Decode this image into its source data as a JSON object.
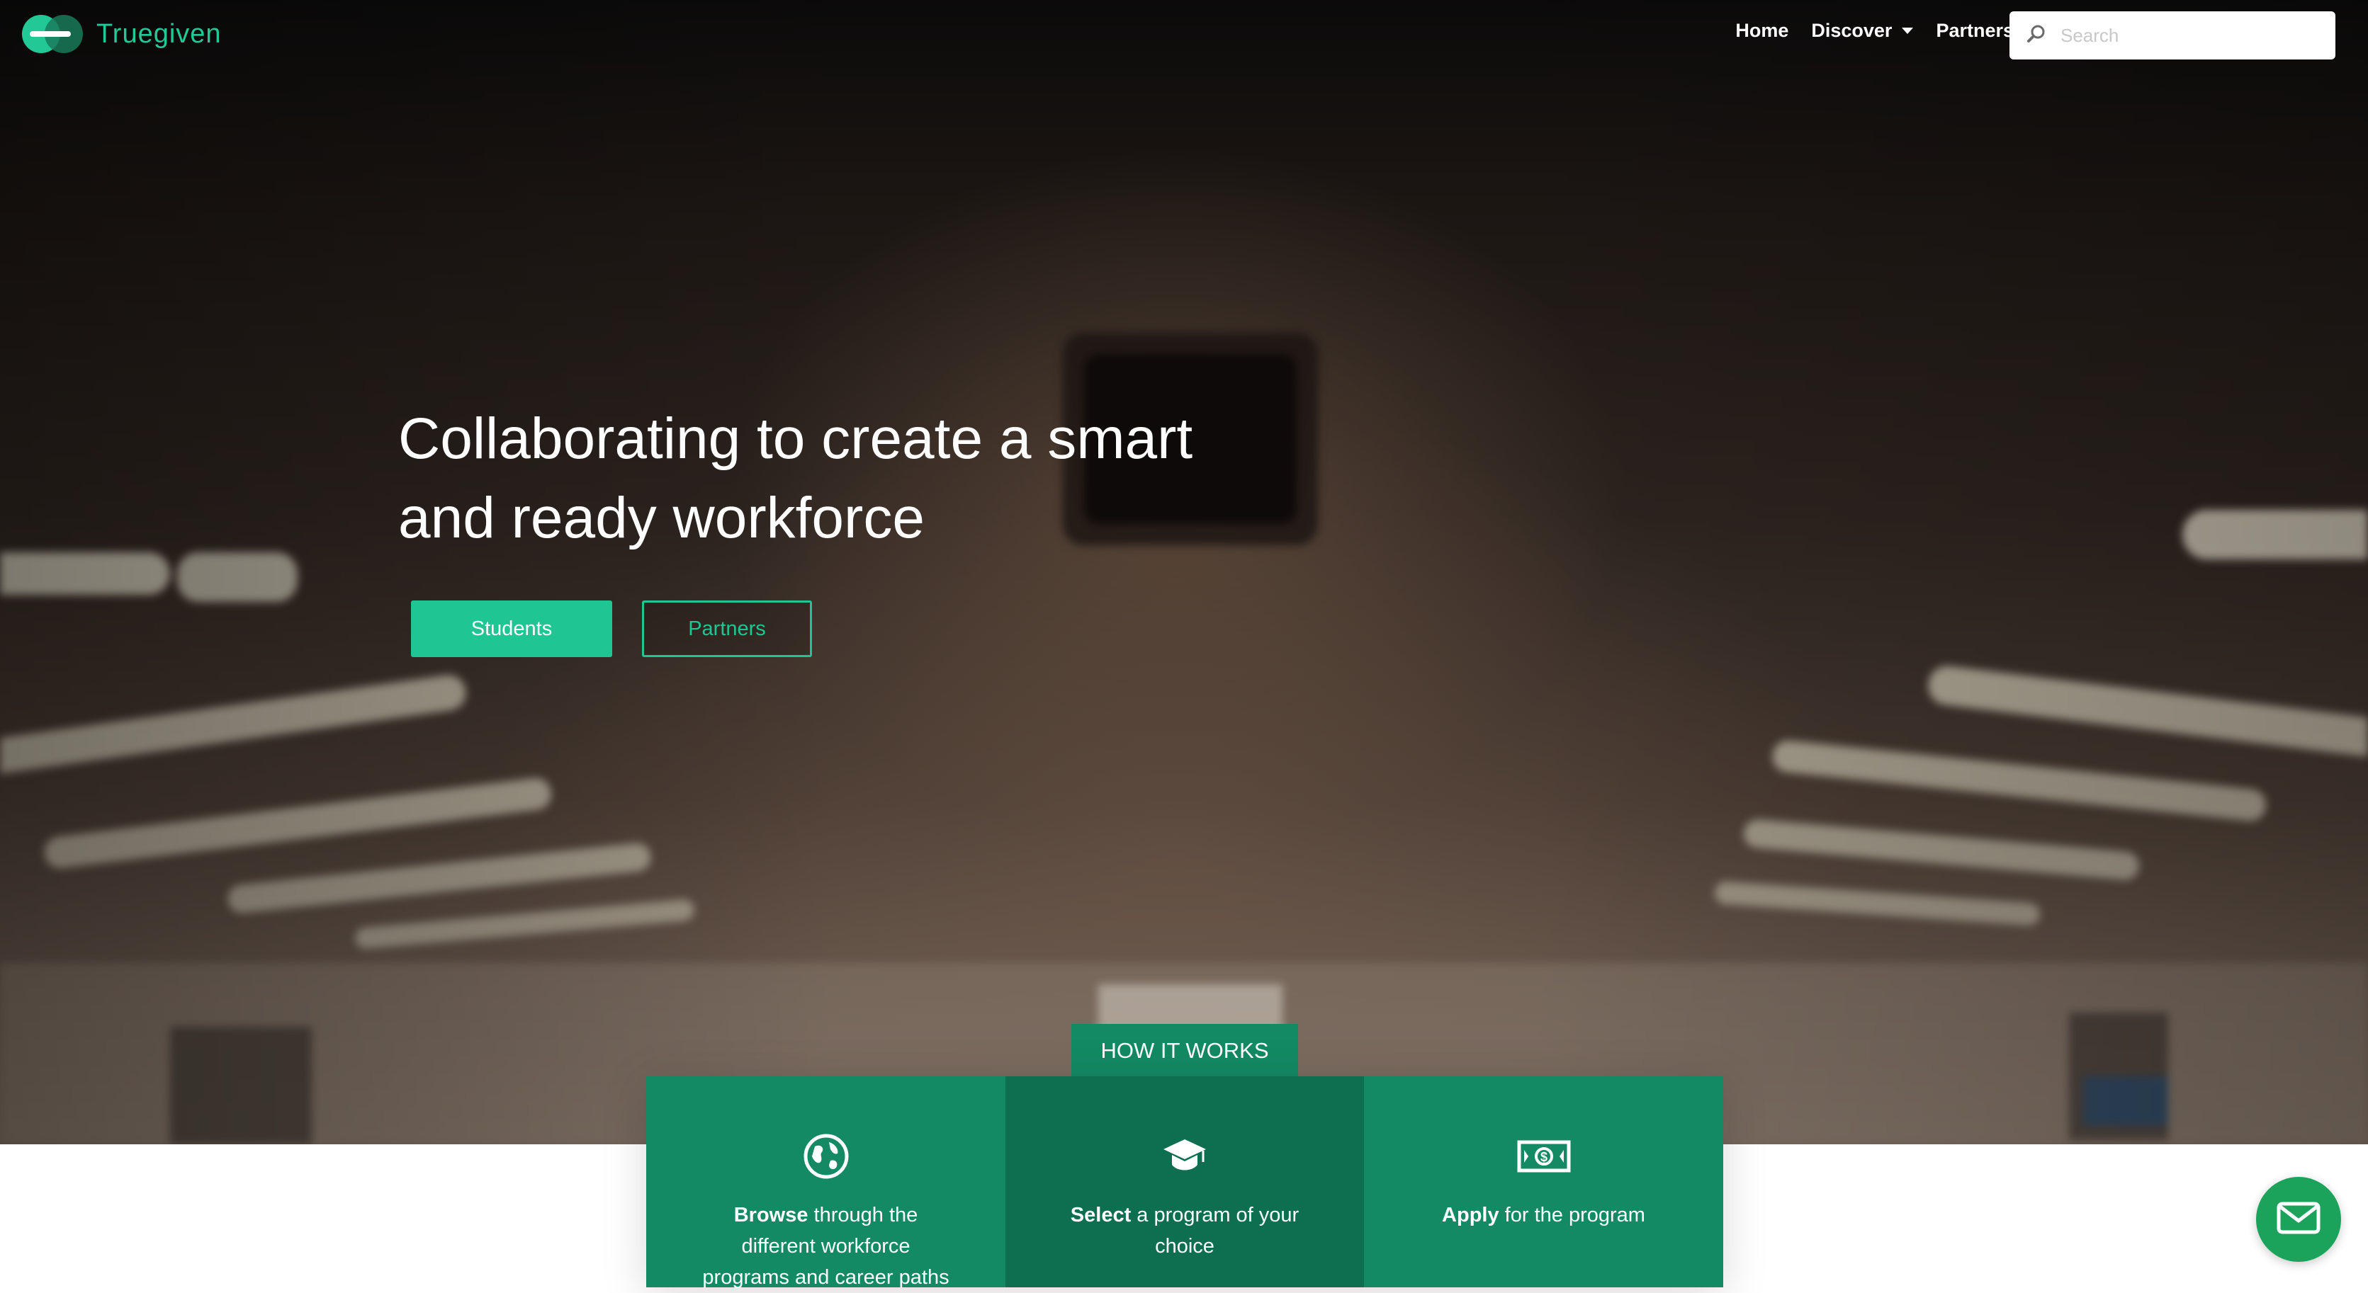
{
  "brand": {
    "name": "Truegiven",
    "accent": "#1fc592"
  },
  "nav": {
    "home": "Home",
    "discover": "Discover",
    "partners": "Partners",
    "search_placeholder": "Search"
  },
  "hero": {
    "headline_line1": "Collaborating to create a smart",
    "headline_line2": "and ready workforce",
    "students_button": "Students",
    "partners_button": "Partners"
  },
  "how_it_works": {
    "title": "HOW IT WORKS",
    "steps": [
      {
        "icon": "globe-icon",
        "bold": "Browse",
        "text": " through the different workforce programs and career paths"
      },
      {
        "icon": "graduation-cap-icon",
        "bold": "Select",
        "text": " a program of your choice"
      },
      {
        "icon": "money-icon",
        "bold": "Apply",
        "text": " for the program"
      }
    ]
  },
  "chat": {
    "icon": "envelope-icon"
  },
  "colors": {
    "tile": "#138a63",
    "tile_mid": "#0e6f50",
    "chat": "#1ba25b"
  }
}
